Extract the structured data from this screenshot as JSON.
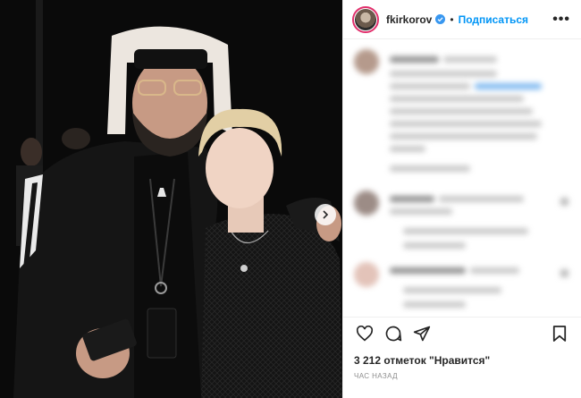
{
  "post": {
    "username": "fkirkorov",
    "follow_label": "Подписаться",
    "separator": "•",
    "more_label": "•••",
    "likes_text": "3 212 отметок \"Нравится\"",
    "time_text": "ЧАС НАЗАД"
  },
  "icons": {
    "verified": "verified-badge-icon",
    "like": "heart-icon",
    "comment": "comment-icon",
    "share": "send-icon",
    "save": "bookmark-icon",
    "next": "chevron-right-icon"
  },
  "colors": {
    "follow": "#0095f6",
    "verified": "#3897f0",
    "text": "#262626",
    "muted": "#8e8e8e"
  }
}
